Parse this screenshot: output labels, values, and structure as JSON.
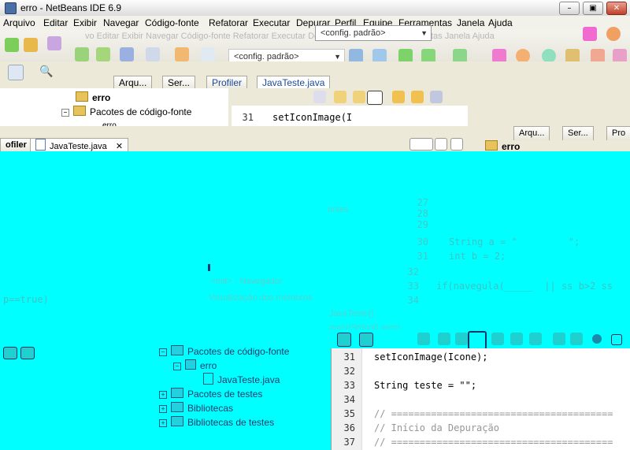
{
  "window": {
    "title": "erro - NetBeans IDE 6.9",
    "minimize_glyph": "–",
    "maximize_glyph": "▣",
    "close_glyph": "✕"
  },
  "menu": [
    "Arquivo",
    "Editar",
    "Exibir",
    "Navegar",
    "Código-fonte",
    "Refatorar",
    "Executar",
    "Depurar",
    "Perfil",
    "Equipe",
    "Ferramentas",
    "Janela",
    "Ajuda"
  ],
  "toolbar": {
    "config_combo_top": "<config. padrão>",
    "config_combo_second": "<config. padrão>"
  },
  "ghost_menu_text": "vo Editar Exibir Navegar Código-fonte Refatorar Executar Depurar Perfil Equipe Ferramentas Janela Ajuda",
  "upper_tabs": {
    "arquivos": "Arqu...",
    "servicos": "Ser...",
    "profiler": "Profiler",
    "editor_file": "JavaTeste.java"
  },
  "upper_tree": {
    "project": "erro",
    "source_packages": "Pacotes de código-fonte",
    "partial": "erro"
  },
  "upper_editor": {
    "line_no": "31",
    "code": "setIconImage(I"
  },
  "right_panel": {
    "tab1": "Arqu...",
    "tab2": "Ser...",
    "tab3": "Pro",
    "project": "erro"
  },
  "middle_tabs": {
    "profiler": "ofiler",
    "editor_file": "JavaTeste.java"
  },
  "ghost_texts": {
    "antes": "antes",
    "nav_title": "<init> - Navegador",
    "membros": "Visualização dos membros",
    "classe": "JavaTeste()",
    "main": "main(String[] args)",
    "ptrue": "p==true)",
    "string_a": "String a = \"         \";",
    "int_b": "int b = 2;",
    "if_line": "if(navegula(_____  || ss b>2 ss"
  },
  "ghost_line_numbers": [
    "27",
    "28",
    "29",
    "30",
    "31",
    "32",
    "33",
    "34"
  ],
  "lower_tree": [
    {
      "label": "Pacotes de código-fonte",
      "type": "folder",
      "expander": "−"
    },
    {
      "label": "erro",
      "type": "package",
      "expander": "−"
    },
    {
      "label": "JavaTeste.java",
      "type": "file",
      "expander": ""
    },
    {
      "label": "Pacotes de testes",
      "type": "folder",
      "expander": "+"
    },
    {
      "label": "Bibliotecas",
      "type": "lib",
      "expander": "+"
    },
    {
      "label": "Bibliotecas de testes",
      "type": "lib",
      "expander": "+"
    }
  ],
  "lower_editor": {
    "lines": [
      {
        "no": "31",
        "code": "setIconImage(Icone);"
      },
      {
        "no": "32",
        "code": ""
      },
      {
        "no": "33",
        "code": "String teste = \"\";"
      },
      {
        "no": "34",
        "code": ""
      },
      {
        "no": "35",
        "code": "// ======================================="
      },
      {
        "no": "36",
        "code": "// Início da Depuração"
      },
      {
        "no": "37",
        "code": "// ======================================="
      }
    ]
  },
  "colors": {
    "overlay": "#00ffff",
    "window_bg": "#ece9d8",
    "accent": "#316ac5"
  }
}
